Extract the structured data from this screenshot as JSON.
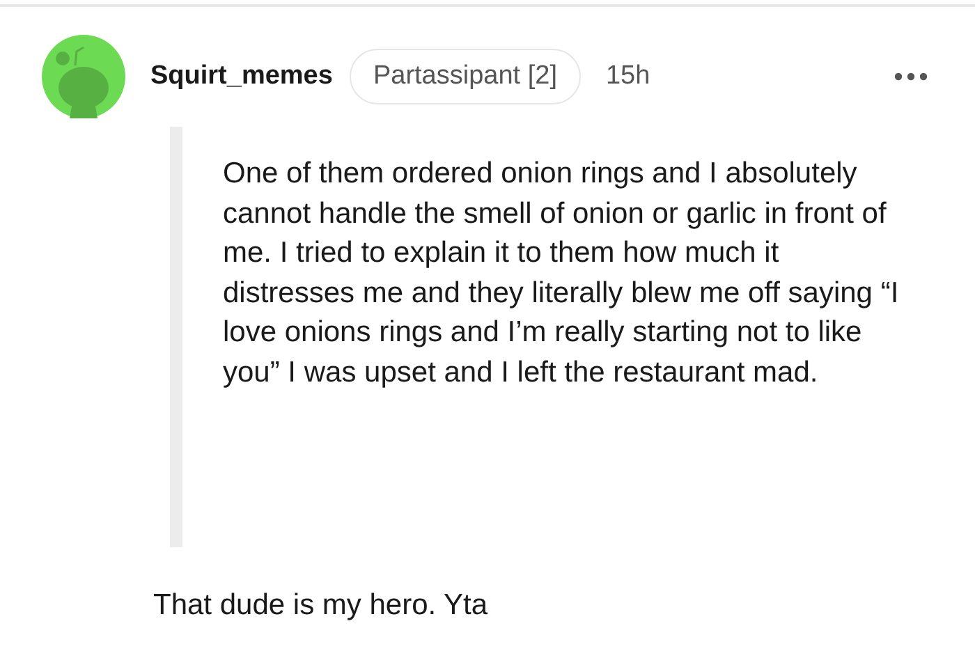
{
  "comment": {
    "username": "Squirt_memes",
    "flair": "Partassipant [2]",
    "time": "15h",
    "quote": "One of them ordered onion rings and I absolutely cannot handle the smell of onion or garlic in front of me. I tried to explain it to them how much it distresses me and they literally blew me off saying “I love onions rings and I’m really starting not to like you” I was upset and I left the restaurant mad.",
    "body": "That dude is my hero. Yta"
  }
}
